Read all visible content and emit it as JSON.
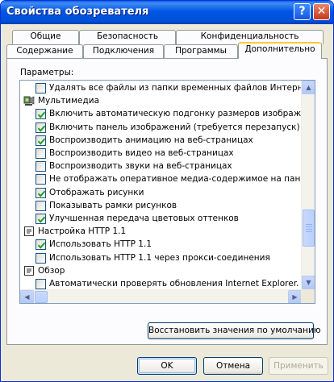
{
  "window": {
    "title": "Свойства обозревателя"
  },
  "titlebar_buttons": {
    "help": "?",
    "close": "✕"
  },
  "tabs_back": [
    "Общие",
    "Безопасность",
    "Конфиденциальность"
  ],
  "tabs_front": [
    "Содержание",
    "Подключения",
    "Программы",
    "Дополнительно"
  ],
  "panel": {
    "label": "Параметры:"
  },
  "rows": [
    {
      "type": "item",
      "checked": false,
      "label": "Удалять все файлы из папки временных файлов Интернета"
    },
    {
      "type": "group",
      "icon": "multimedia-icon",
      "label": "Мультимедиа"
    },
    {
      "type": "item",
      "checked": true,
      "label": "Включить автоматическую подгонку размеров изображени"
    },
    {
      "type": "item",
      "checked": true,
      "label": "Включить панель изображений (требуется перезапуск)"
    },
    {
      "type": "item",
      "checked": true,
      "label": "Воспроизводить анимацию на веб-страницах"
    },
    {
      "type": "item",
      "checked": false,
      "label": "Воспроизводить видео на веб-страницах"
    },
    {
      "type": "item",
      "checked": false,
      "label": "Воспроизводить звуки на веб-страницах"
    },
    {
      "type": "item",
      "checked": false,
      "label": "Не отображать оперативное медиа-содержимое на панели"
    },
    {
      "type": "item",
      "checked": true,
      "label": "Отображать рисунки"
    },
    {
      "type": "item",
      "checked": false,
      "label": "Показывать рамки рисунков"
    },
    {
      "type": "item",
      "checked": true,
      "label": "Улучшенная передача цветовых оттенков"
    },
    {
      "type": "group",
      "icon": "http-settings-icon",
      "label": "Настройка HTTP 1.1"
    },
    {
      "type": "item",
      "checked": true,
      "label": "Использовать HTTP 1.1"
    },
    {
      "type": "item",
      "checked": false,
      "label": "Использовать HTTP 1.1 через прокси-соединения"
    },
    {
      "type": "group",
      "icon": "browse-icon",
      "label": "Обзор"
    },
    {
      "type": "item",
      "checked": false,
      "label": "Автоматически проверять обновления Internet Explorer."
    }
  ],
  "buttons": {
    "restore_defaults": "Восстановить значения по умолчанию",
    "ok": "OK",
    "cancel": "Отмена",
    "apply": "Применить"
  },
  "colors": {
    "title_bar": "#0054E3",
    "dialog_bg": "#ECE9D8",
    "tab_highlight": "#FFC83C",
    "check": "#21A121"
  }
}
